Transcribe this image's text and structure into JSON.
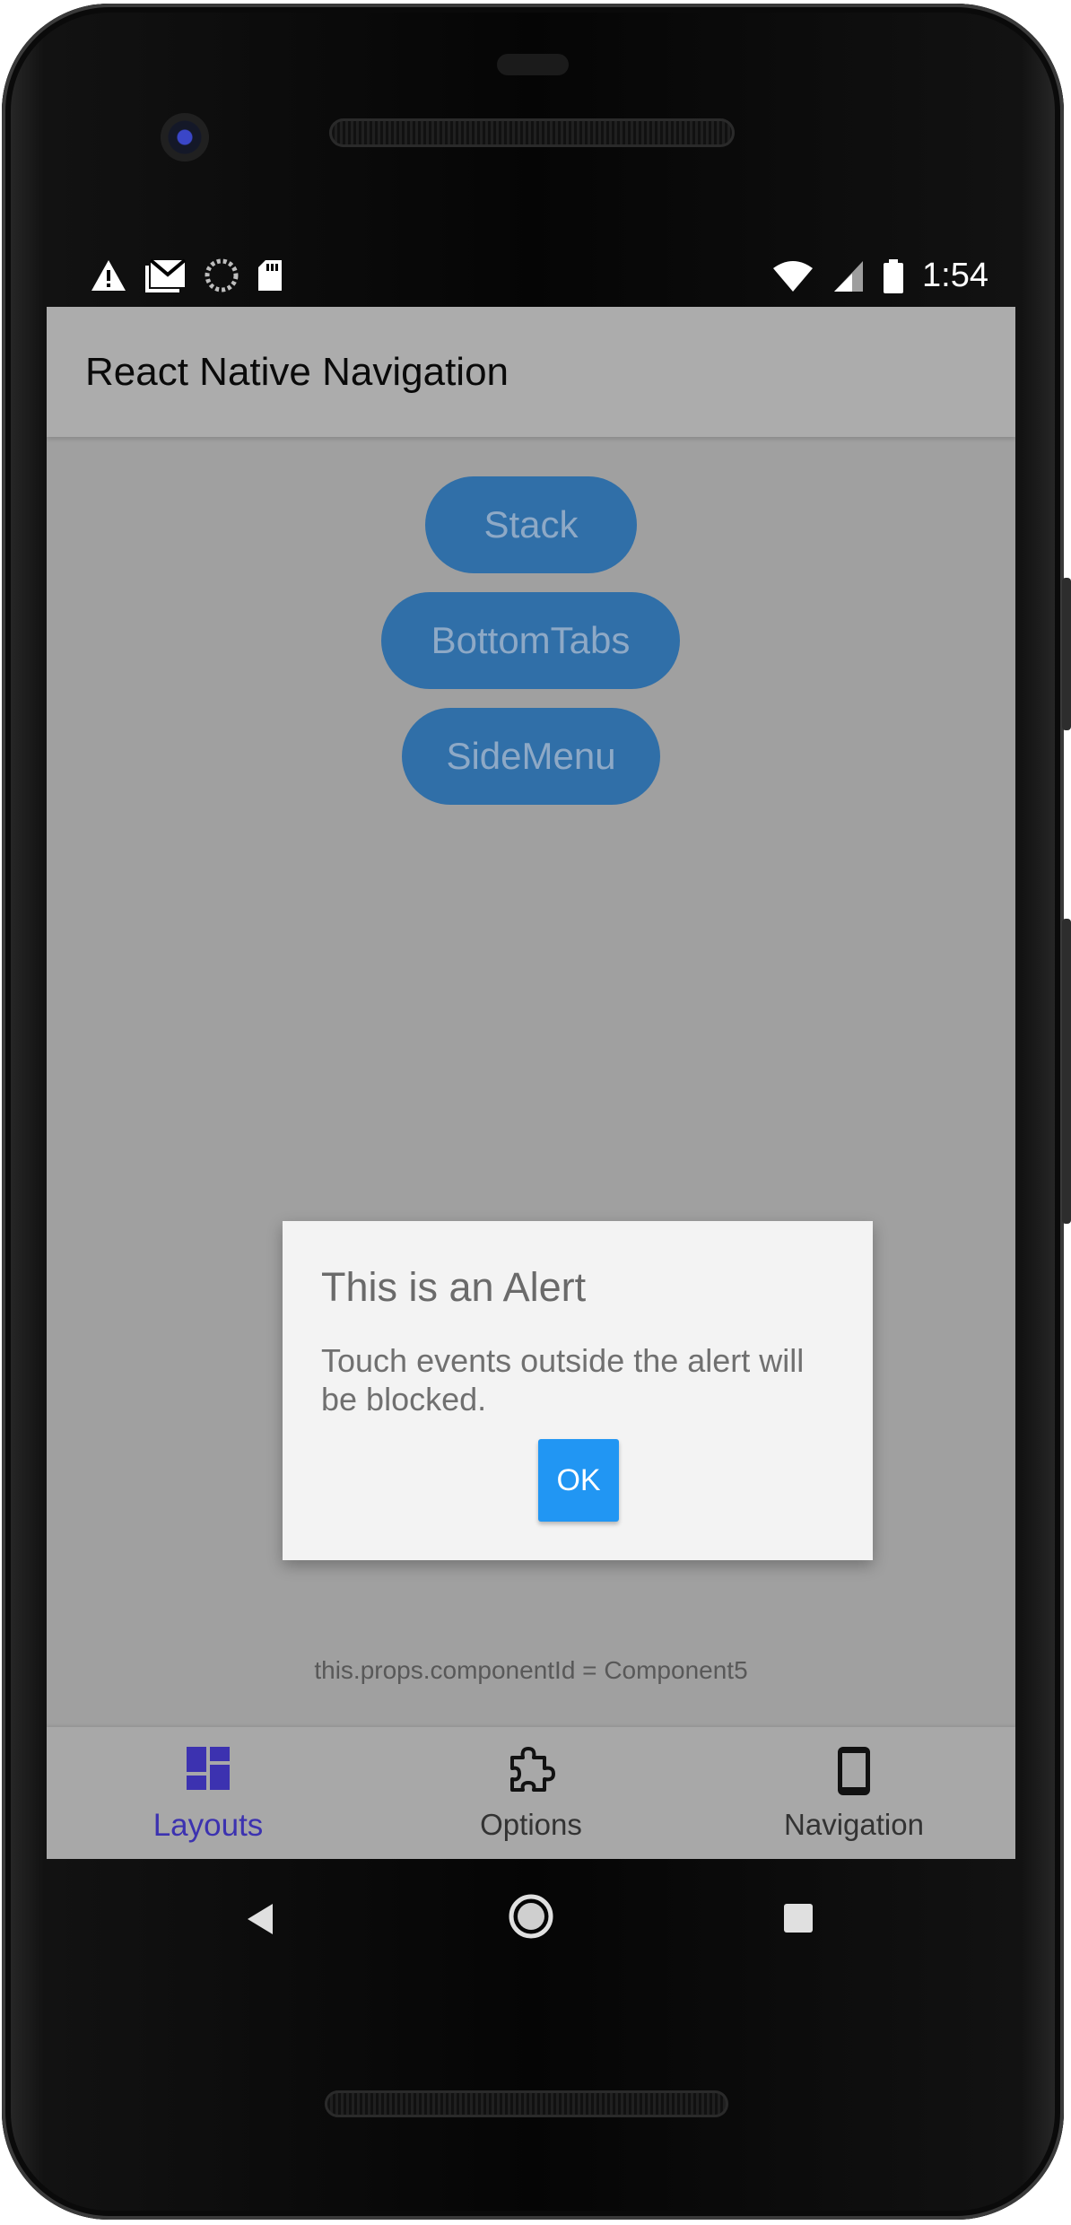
{
  "status_bar": {
    "time": "1:54",
    "icons_left": [
      "warning-icon",
      "gmail-icon",
      "sync-icon",
      "sd-card-icon"
    ],
    "icons_right": [
      "wifi-icon",
      "signal-icon",
      "battery-icon"
    ]
  },
  "app_bar": {
    "title": "React Native Navigation"
  },
  "buttons": {
    "stack": "Stack",
    "bottom_tabs": "BottomTabs",
    "side_menu": "SideMenu"
  },
  "alert": {
    "title": "This is an Alert",
    "message": "Touch events outside the alert will be blocked.",
    "ok_label": "OK"
  },
  "component_id": "this.props.componentId = Component5",
  "bottom_tabs": [
    {
      "label": "Layouts",
      "icon": "dashboard-icon",
      "active": true
    },
    {
      "label": "Options",
      "icon": "puzzle-icon",
      "active": false
    },
    {
      "label": "Navigation",
      "icon": "phone-icon",
      "active": false
    }
  ],
  "colors": {
    "accent": "#3c32b0",
    "button": "#306fa8",
    "alert_button": "#2196f3",
    "overlay_bg": "#a0a0a0"
  }
}
